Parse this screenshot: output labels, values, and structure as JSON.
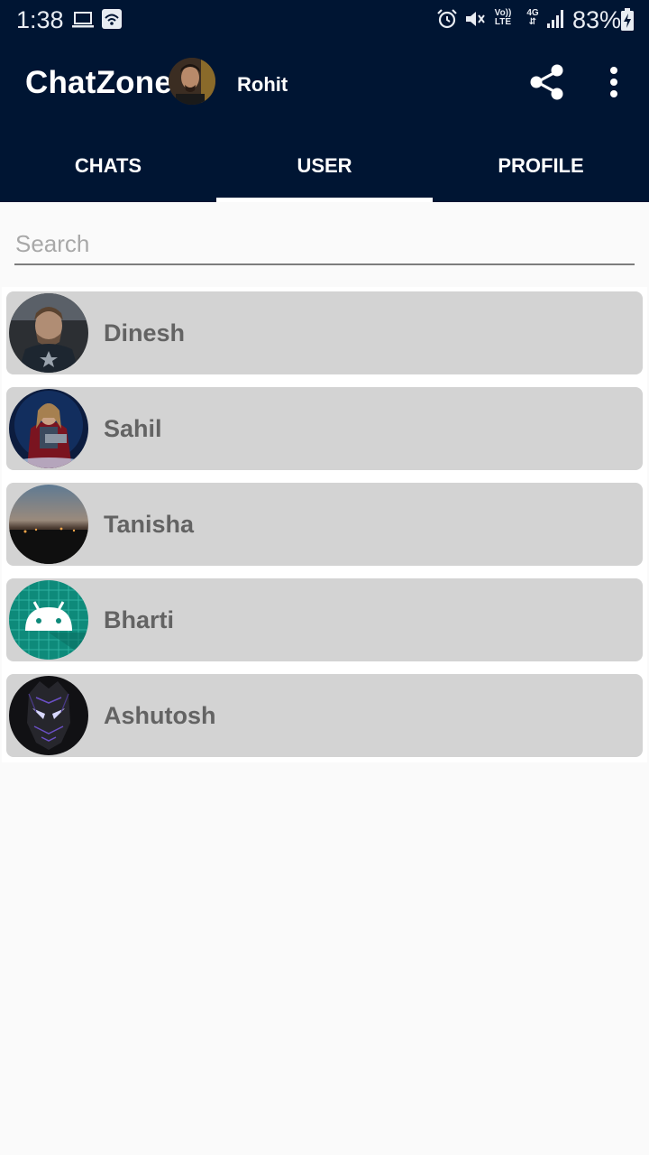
{
  "status_bar": {
    "time": "1:38",
    "volte_top": "Vo))",
    "volte_bottom": "LTE",
    "network_type": "4G",
    "battery_percent": "83%"
  },
  "app_bar": {
    "title": "ChatZone",
    "current_user_name": "Rohit"
  },
  "tabs": [
    {
      "label": "CHATS"
    },
    {
      "label": "USER"
    },
    {
      "label": "PROFILE"
    }
  ],
  "search": {
    "placeholder": "Search"
  },
  "users": [
    {
      "name": "Dinesh"
    },
    {
      "name": "Sahil"
    },
    {
      "name": "Tanisha"
    },
    {
      "name": "Bharti"
    },
    {
      "name": "Ashutosh"
    }
  ],
  "colors": {
    "app_bar_bg": "#001533",
    "list_card_bg": "#d3d3d3",
    "name_text": "#636363"
  }
}
